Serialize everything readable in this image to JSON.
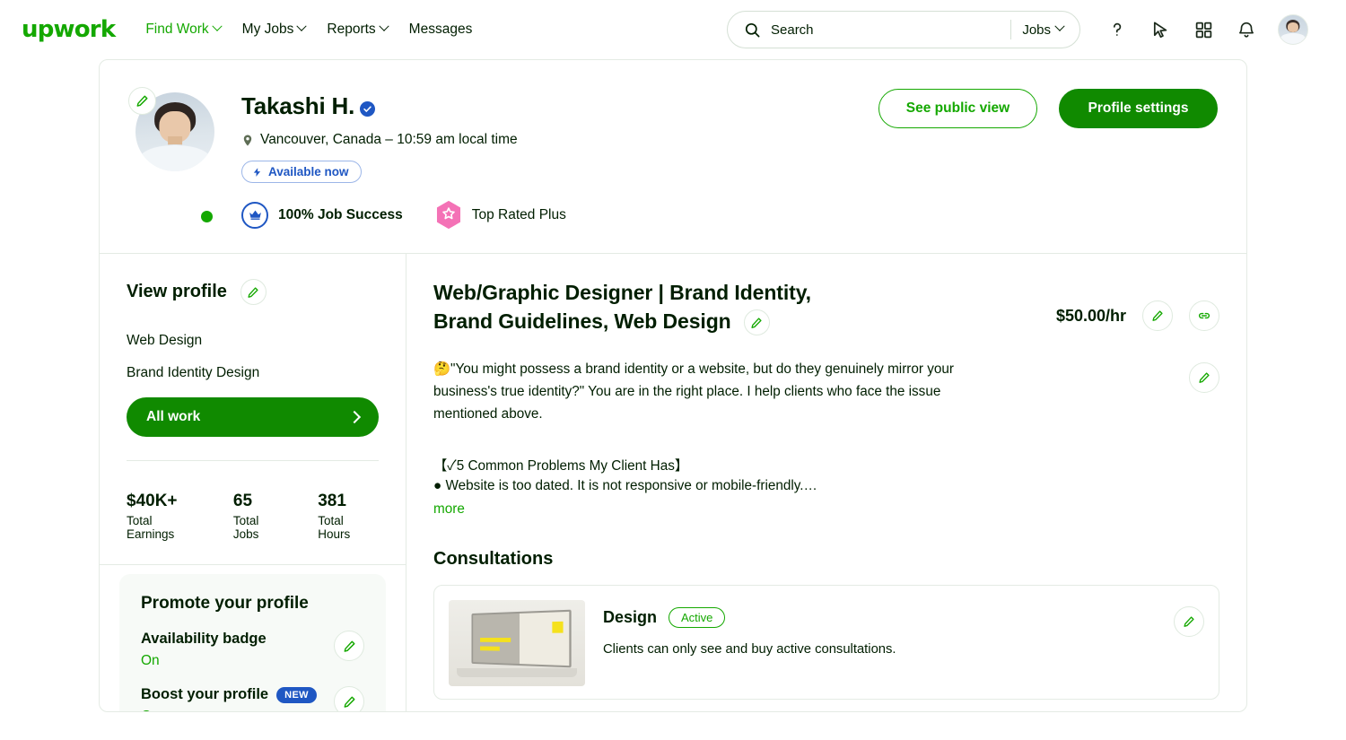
{
  "nav": {
    "logo": "upwork",
    "links": [
      {
        "label": "Find Work",
        "has_caret": true,
        "active": true
      },
      {
        "label": "My Jobs",
        "has_caret": true,
        "active": false
      },
      {
        "label": "Reports",
        "has_caret": true,
        "active": false
      },
      {
        "label": "Messages",
        "has_caret": false,
        "active": false
      }
    ],
    "search": {
      "placeholder": "Search",
      "scope": "Jobs",
      "search_icon": "search-icon",
      "caret_icon": "chevron-down-icon"
    },
    "icons": [
      {
        "name": "help-icon",
        "glyph": "?"
      },
      {
        "name": "cursor-icon",
        "glyph": "cursor"
      },
      {
        "name": "apps-grid-icon",
        "glyph": "grid"
      },
      {
        "name": "notifications-bell-icon",
        "glyph": "bell"
      }
    ],
    "avatar_name": "user-avatar"
  },
  "profile": {
    "name": "Takashi H.",
    "verified_icon": "verified-badge-icon",
    "location_icon": "location-pin-icon",
    "location": "Vancouver, Canada – 10:59 am local time",
    "availability": {
      "label": "Available now",
      "icon": "lightning-bolt-icon"
    },
    "badges": [
      {
        "name": "job-success-badge",
        "label": "100% Job Success",
        "icon": "crown-icon",
        "color": "#1f57c3"
      },
      {
        "name": "top-rated-plus-badge",
        "label": "Top Rated Plus",
        "icon": "star-hexagon-icon",
        "color": "#f472b6"
      }
    ],
    "actions": {
      "see_public_view": "See public view",
      "profile_settings": "Profile settings"
    },
    "edit_icon": "pencil-icon",
    "online_status": "online"
  },
  "sidebar": {
    "view_profile": "View profile",
    "links": [
      {
        "label": "Web Design",
        "active": false
      },
      {
        "label": "Brand Identity Design",
        "active": false
      },
      {
        "label": "All work",
        "active": true
      }
    ],
    "stats": [
      {
        "value": "$40K+",
        "label": "Total Earnings"
      },
      {
        "value": "65",
        "label": "Total Jobs"
      },
      {
        "value": "381",
        "label": "Total Hours"
      }
    ],
    "promote": {
      "title": "Promote your profile",
      "items": [
        {
          "label": "Availability badge",
          "value": "On",
          "badge": null
        },
        {
          "label": "Boost your profile",
          "value": "On",
          "badge": "NEW"
        }
      ]
    }
  },
  "main": {
    "job_title": "Web/Graphic Designer | Brand Identity, Brand Guidelines, Web Design",
    "rate": "$50.00/hr",
    "link_icon": "link-icon",
    "description": "🤔\"You might possess a brand identity or a website, but do they genuinely mirror your business's true identity?\" You are in the right place. I help clients who face the issue mentioned above.",
    "list_heading": "【✓5 Common Problems My Client Has】",
    "list_item": "● Website is too dated. It is not responsive or mobile-friendly.…",
    "more_label": "more",
    "consultations": {
      "title": "Consultations",
      "items": [
        {
          "name": "Design",
          "status": "Active",
          "note": "Clients can only see and buy active consultations.",
          "thumbnail_name": "consultation-thumbnail"
        }
      ]
    }
  },
  "colors": {
    "brand_green": "#14a800",
    "button_green": "#108a00",
    "blue": "#1f57c3",
    "pink": "#f472b6",
    "border": "#e4ebe4"
  }
}
